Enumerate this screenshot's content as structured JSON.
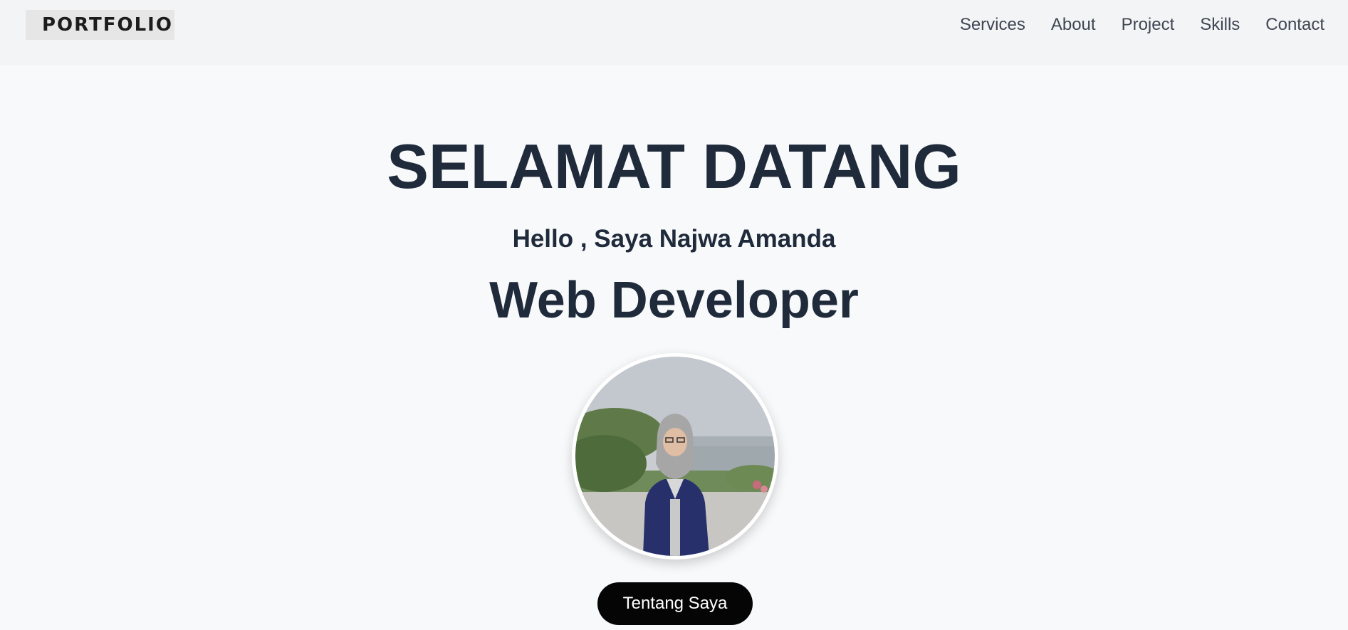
{
  "header": {
    "logo_text": "PORTFOLIO",
    "nav": [
      {
        "label": "Services"
      },
      {
        "label": "About"
      },
      {
        "label": "Project"
      },
      {
        "label": "Skills"
      },
      {
        "label": "Contact"
      }
    ]
  },
  "hero": {
    "title": "SELAMAT DATANG",
    "greeting": "Hello , Saya Najwa Amanda",
    "role": "Web Developer",
    "cta_label": "Tentang Saya"
  },
  "colors": {
    "text": "#1f2a3a",
    "button_bg": "#050505",
    "page_bg": "#f8f9fb",
    "header_bg": "#f3f4f5"
  }
}
